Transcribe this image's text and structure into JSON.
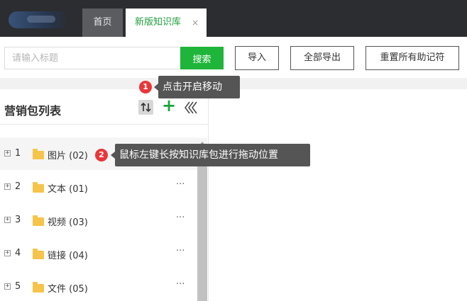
{
  "header": {
    "tabs": [
      {
        "label": "首页"
      },
      {
        "label": "新版知识库",
        "close": "×"
      }
    ]
  },
  "toolbar": {
    "search_placeholder": "请输入标题",
    "search_value": "",
    "search_label": "搜索",
    "import_label": "导入",
    "export_label": "全部导出",
    "reset_label": "重置所有助记符"
  },
  "panel": {
    "title": "营销包列表",
    "add_label": "+",
    "items": [
      {
        "num": "1",
        "label": "图片 (02)"
      },
      {
        "num": "2",
        "label": "文本 (01)"
      },
      {
        "num": "3",
        "label": "视频 (03)"
      },
      {
        "num": "4",
        "label": "链接 (04)"
      },
      {
        "num": "5",
        "label": "文件 (05)"
      }
    ],
    "expand_glyph": "+",
    "more_glyph": "···"
  },
  "tips": [
    {
      "badge": "1",
      "text": "点击开启移动"
    },
    {
      "badge": "2",
      "text": "鼠标左键长按知识库包进行拖动位置"
    }
  ],
  "icons": [
    "logo",
    "sort-icon",
    "add-icon",
    "collapse-icon",
    "folder-icon",
    "expand-icon",
    "more-icon",
    "close-icon"
  ],
  "colors": {
    "topbar": "#2b2d30",
    "active_tab_text": "#1e9e3c",
    "search_button": "#1fb53a",
    "folder": "#f6c44a",
    "badge": "#e8373c",
    "tooltip": "#555555"
  }
}
